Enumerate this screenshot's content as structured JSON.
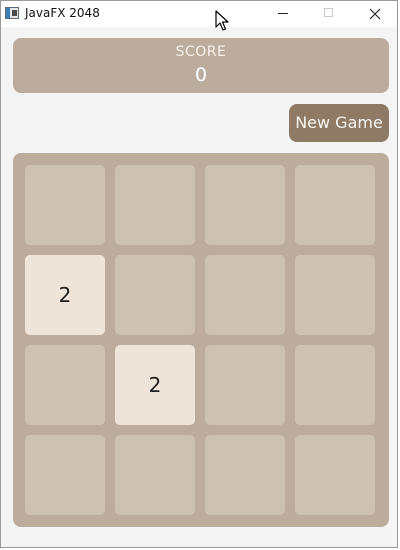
{
  "window": {
    "title": "JavaFX 2048",
    "icons": [
      "app-icon",
      "cursor-icon",
      "minimize-icon",
      "maximize-icon",
      "close-icon"
    ]
  },
  "score": {
    "label": "SCORE",
    "value": "0"
  },
  "new_game_label": "New Game",
  "board": {
    "rows": [
      [
        "",
        "",
        "",
        ""
      ],
      [
        "2",
        "",
        "",
        ""
      ],
      [
        "",
        "2",
        "",
        ""
      ],
      [
        "",
        "",
        "",
        ""
      ]
    ]
  },
  "colors": {
    "board_bg": "#bcac9e",
    "empty_cell": "#cdc1b4",
    "tile_2": "#eee4da",
    "button_bg": "#8f7a65"
  }
}
